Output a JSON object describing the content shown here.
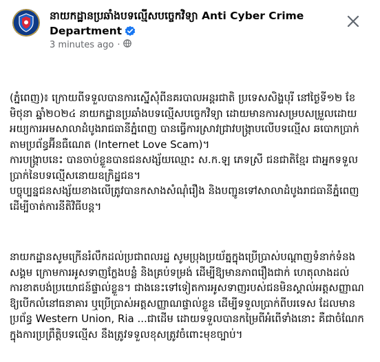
{
  "post": {
    "page_name": "នាយកដ្ឋានប្រឆាំងបទល្មើសបច្ចេកវិទ្យា Anti Cyber Crime Department",
    "timestamp": "3 minutes ago",
    "separator": "·",
    "icons": {
      "avatar": "department-badge-avatar",
      "verified": "verified-badge-icon",
      "privacy": "globe-icon",
      "close": "close-icon"
    },
    "colors": {
      "verified": "#1877f2",
      "meta_text": "#65676b",
      "body_text": "#050505"
    },
    "paragraphs": [
      "(ភ្នំពេញ)៖ ក្រោយពីទទួលបានការស្នើសុំពីនគរបាលអន្តរជាតិ ប្រទេសសិង្ហបុរី នៅថ្ងៃទី១២ ខែមិថុនា ឆ្នាំ២០២៤ នាយកដ្ឋានប្រឆាំងបទល្មើសបច្ចេកវិទ្យា ដោយមានការសម្របសម្រួលដោយអយ្យការអមសាលាដំបូងរាជធានីភ្នំពេញ បានធ្វើការស្រាវជ្រាវបង្ក្រាបលើបទល្មើស ឆបោកប្រាក់តាមប្រព័ន្ធអ៊ីនធឺណេត (Internet Love Scam)។\nការបង្ក្រាបនេះ បានចាប់ខ្លួនបានជនសង្ស័យឈ្មោះ ស.ក.ឡ ភេទស្រី ជនជាតិខ្មែរ ជាអ្នកទទួលប្រាក់នៃបទល្មើសនោយឧក្រិដ្ឋជន។\nបច្ចុប្បន្នជនសង្ស័យខាងលើត្រូវបានកសាងសំណុំរឿង និងបញ្ជូនទៅសាលាដំបូងរាជធានីភ្នំពេញដើម្បីចាត់ការនីតិវិធីបន្ត។",
      "នាយកដ្ឋានសូមក្រើនរំលឹកដល់ប្រជាពលរដ្ឋ សូមប្រុងប្រយ័ត្នក្នុងប្រើប្រាស់បណ្តាញទំនាក់ទំនងសង្គម ក្រោមការអូសទាញក្លែងបន្លំ និងគ្រប់ទម្រង់ ដើម្បីឱ្យមានភាពរឿងជាក់ ហេតុលាងដល់ការខាតបង់ប្រយោជន៍ផ្ទាល់ខ្លួន។ ជាងនេះទៅទៀតការអូសទាញរបស់ជនមិនស្គាល់អត្តសញ្ញាណ ឱ្យបើកលំនៅធនាគារ ឬប្រើប្រាស់អត្តសញ្ញាណផ្ទាល់ខ្លួន ដើម្បីទទួលប្រាក់ពីបរទេស ដែលមានប្រព័ន្ធ Western Union, Ria ...ជាដើម ដោយទទួលបានកម្រៃពីអំពើទាំងនោះ គឺជាចំណែកក្នុងការប្រព្រឹត្តិបទល្មើស នឹងត្រូវទទួលខុសត្រូវចំពោះមុខច្បាប់។"
    ]
  }
}
